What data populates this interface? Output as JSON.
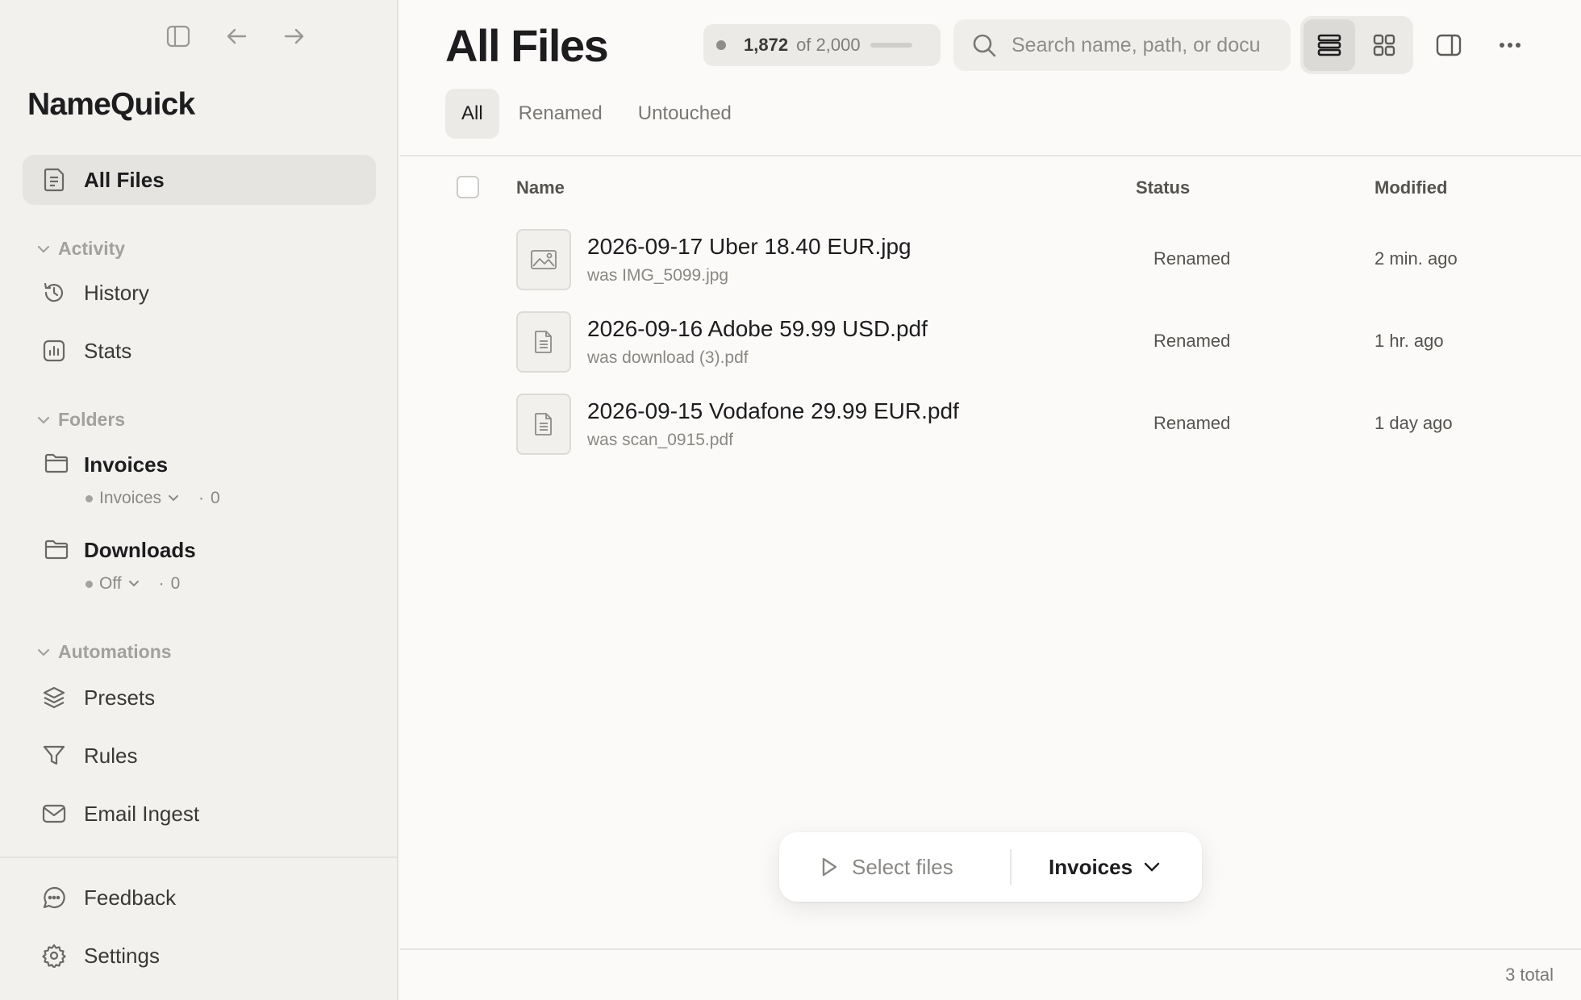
{
  "app": {
    "name": "NameQuick"
  },
  "sidebar": {
    "all_files": "All Files",
    "activity": {
      "label": "Activity",
      "items": [
        "History",
        "Stats"
      ]
    },
    "folders": {
      "label": "Folders",
      "items": [
        {
          "name": "Invoices",
          "preset": "Invoices",
          "count": "0"
        },
        {
          "name": "Downloads",
          "preset": "Off",
          "count": "0"
        }
      ]
    },
    "automations": {
      "label": "Automations",
      "items": [
        "Presets",
        "Rules",
        "Email Ingest"
      ]
    },
    "footer": [
      "Feedback",
      "Settings"
    ]
  },
  "header": {
    "title": "All Files",
    "quota": {
      "used": "1,872",
      "of": "of 2,000",
      "fraction": 0.936
    },
    "search_placeholder": "Search name, path, or document"
  },
  "tabs": [
    "All",
    "Renamed",
    "Untouched"
  ],
  "table": {
    "columns": {
      "name": "Name",
      "status": "Status",
      "modified": "Modified"
    },
    "rows": [
      {
        "name": "2026-09-17 Uber 18.40 EUR.jpg",
        "was": "was IMG_5099.jpg",
        "status": "Renamed",
        "modified": "2 min. ago",
        "icon": "image-icon"
      },
      {
        "name": "2026-09-16 Adobe 59.99 USD.pdf",
        "was": "was download (3).pdf",
        "status": "Renamed",
        "modified": "1 hr. ago",
        "icon": "document-icon"
      },
      {
        "name": "2026-09-15 Vodafone 29.99 EUR.pdf",
        "was": "was scan_0915.pdf",
        "status": "Renamed",
        "modified": "1 day ago",
        "icon": "document-icon"
      }
    ]
  },
  "action_bar": {
    "select_files": "Select files",
    "preset": "Invoices"
  },
  "footer": {
    "total": "3 total"
  }
}
